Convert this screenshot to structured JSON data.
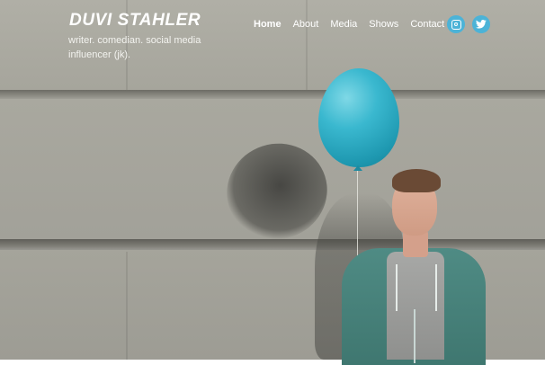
{
  "site": {
    "brand": "DUVI STAHLER",
    "tagline": "writer. comedian. social media influencer (jk)."
  },
  "nav": {
    "items": [
      {
        "label": "Home",
        "active": true
      },
      {
        "label": "About",
        "active": false
      },
      {
        "label": "Media",
        "active": false
      },
      {
        "label": "Shows",
        "active": false
      },
      {
        "label": "Contact",
        "active": false
      }
    ]
  },
  "social": {
    "icons": [
      "instagram-icon",
      "twitter-icon"
    ],
    "accent": "#4cb3d7"
  },
  "hero": {
    "balloon_color": "#3ab8cf"
  }
}
